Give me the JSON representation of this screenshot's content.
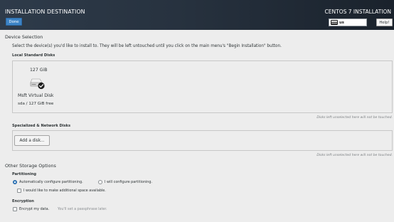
{
  "header": {
    "title": "INSTALLATION DESTINATION",
    "done_label": "Done",
    "product": "CENTOS 7 INSTALLATION",
    "keyboard_layout": "us",
    "help_label": "Help!"
  },
  "device_selection": {
    "heading": "Device Selection",
    "description": "Select the device(s) you'd like to install to.  They will be left untouched until you click on the main menu's \"Begin Installation\" button.",
    "local_heading": "Local Standard Disks",
    "disk": {
      "size": "127 GiB",
      "name": "Msft Virtual Disk",
      "info": "sda   /   127 GiB free",
      "icon": "hard-disk-icon",
      "selected": true
    },
    "local_hint": "Disks left unselected here will not be touched.",
    "network_heading": "Specialized & Network Disks",
    "add_disk_label": "Add a disk...",
    "network_hint": "Disks left unselected here will not be touched."
  },
  "other_storage": {
    "heading": "Other Storage Options",
    "partitioning_heading": "Partitioning",
    "auto_label": "Automatically configure partitioning.",
    "manual_label": "I will configure partitioning.",
    "space_label": "I would like to make additional space available.",
    "encryption_heading": "Encryption",
    "encrypt_label": "Encrypt my data.",
    "encrypt_hint": "You'll set a passphrase later."
  },
  "colors": {
    "header_bg": "#27323f",
    "accent": "#3d84c6",
    "page_bg": "#ededed"
  }
}
